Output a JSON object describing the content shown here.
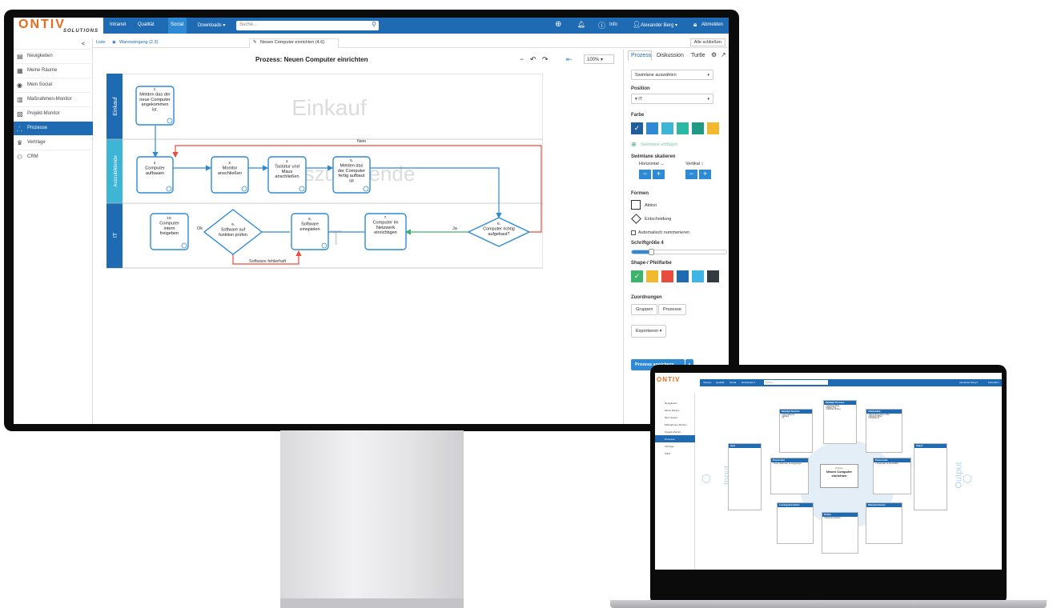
{
  "nav": {
    "logo": "ONTIV",
    "logo_sub": "SOLUTIONS",
    "items": [
      "Intranet",
      "Qualität",
      "Social",
      "Downloads ▾"
    ],
    "search_placeholder": "Suche...",
    "info": "Info",
    "user": "Alexander Berg ▾",
    "logout": "Abmelden"
  },
  "sidebar": {
    "collapse": "<",
    "items": [
      {
        "label": "Neuigkeiten",
        "icon": "news-icon"
      },
      {
        "label": "Meine Räume",
        "icon": "grid-icon"
      },
      {
        "label": "Mein Social",
        "icon": "social-icon"
      },
      {
        "label": "Maßnahmen-Monitor",
        "icon": "chart-icon"
      },
      {
        "label": "Projekt-Monitor",
        "icon": "project-icon"
      },
      {
        "label": "Prozesse",
        "icon": "process-icon"
      },
      {
        "label": "Verträge",
        "icon": "contract-icon"
      },
      {
        "label": "CRM",
        "icon": "crm-icon"
      }
    ]
  },
  "tabs": {
    "list": "Liste",
    "wareneingang": "Wareneingang (2.3)",
    "active": "Neuen Computer einrichten (4.6)",
    "close_all": "Alle schließen"
  },
  "process": {
    "title": "Prozess: Neuen Computer einrichten",
    "zoom": "100%",
    "lanes": [
      {
        "name": "Einkauf",
        "watermark": "Einkauf"
      },
      {
        "name": "Auszubildende",
        "watermark": "Auszubildende"
      },
      {
        "name": "IT",
        "watermark": "IT"
      }
    ],
    "nodes": {
      "n1": "1.\nMelden das der\nneue Computer\nangekommen\nist.",
      "n2": "2.\nComputer\naufbauen",
      "n3": "3.\nMonitor\nanschließen",
      "n4": "4.\nTastatur und\nMaus\nanschließen",
      "n5": "5.\nMelden das\nder Computer\nfertig aufbaut\nist",
      "n6": "6.\nComputer richtig\naufgebaut?",
      "n7": "7.\nComputer im\nNetzwerk\neinrichtigen",
      "n8": "8.\nSoftware\neinspielen",
      "n9": "9.\nSoftware auf\nfunktion prüfen",
      "n10": "10.\nComputer\nintern\nfreigeben"
    },
    "edge_labels": {
      "nein": "Nein",
      "ja": "Ja",
      "ok": "Ok",
      "fehler": "Software fehlerhaft"
    }
  },
  "panel": {
    "tabs": [
      "Prozess",
      "Diskussion",
      "Turtle"
    ],
    "swimlane_select": "Swimlane auswählen",
    "position_label": "Position",
    "position_value": "▾ IT",
    "farbe_label": "Farbe",
    "swimlane_colors": [
      "#1f5f9e",
      "#2f8ad6",
      "#3fb5d6",
      "#2bb9a5",
      "#1e9a86",
      "#f2b92f"
    ],
    "add_swimlane": "Swimlane einfügen",
    "scale_label": "Swimlane skalieren",
    "horizontal": "Horizontal ↔",
    "vertikal": "Vertikal ↕",
    "formen_label": "Formen",
    "aktion": "Aktion",
    "entscheidung": "Entscheidung",
    "auto_num": "Automatisch nummerieren",
    "font_size": "Schriftgröße 4",
    "font_size_level": 0.2,
    "shape_color_label": "Shape-/ Pfeilfarbe",
    "shape_colors": [
      "#3db36b",
      "#f2b92f",
      "#e84c3d",
      "#1f6bb3",
      "#3fb5e6",
      "#333a40"
    ],
    "zuordnungen": "Zuordnungen",
    "gruppen": "Gruppen",
    "prozesse": "Prozesse",
    "export": "Exportieren ▾",
    "save": "Prozess speichern"
  },
  "laptop": {
    "cards": {
      "beteiligte_bereiche": {
        "title": "Beteiligte Bereiche",
        "body": "• Auszubildende\n• Einkauf\n• IT"
      },
      "beteiligte_personen": {
        "title": "Beteiligte Personen",
        "body": "• Alexander Berg\n• Daniel Vogt\n• Matthias Tieberg"
      },
      "arbeitsmittel": {
        "title": "Arbeitsmittel",
        "body": "• Microsoft Dynamics NAV\n• Microsoft Office\n• Windows 10"
      },
      "input": {
        "title": "Input",
        "body": ""
      },
      "output": {
        "title": "Output",
        "body": ""
      },
      "prozessstart": {
        "title": "Prozessstart",
        "body": "• Neuer Mitarbeiter ist eingegangen"
      },
      "prozessende": {
        "title": "Prozessende",
        "body": "• Arbeitsplatz ist arbeitsfähig"
      },
      "center": {
        "title": "Prozess",
        "body": "Neuen Computer einrichten"
      },
      "leistungskennzahlen": {
        "title": "Leistungskennzahlen",
        "body": ""
      },
      "relevante_dateien": {
        "title": "Relevante Dateien",
        "body": ""
      },
      "risiken": {
        "title": "Risiken",
        "body": "• Bearbeitungsfehler"
      }
    },
    "side_items": [
      "Neuigkeiten",
      "Meine Räume",
      "Mein Social",
      "Maßnahmen-Monitor",
      "Projekt-Monitor",
      "Prozesse",
      "Verträge",
      "CRM"
    ],
    "input_big": "Input",
    "output_big": "Output"
  }
}
